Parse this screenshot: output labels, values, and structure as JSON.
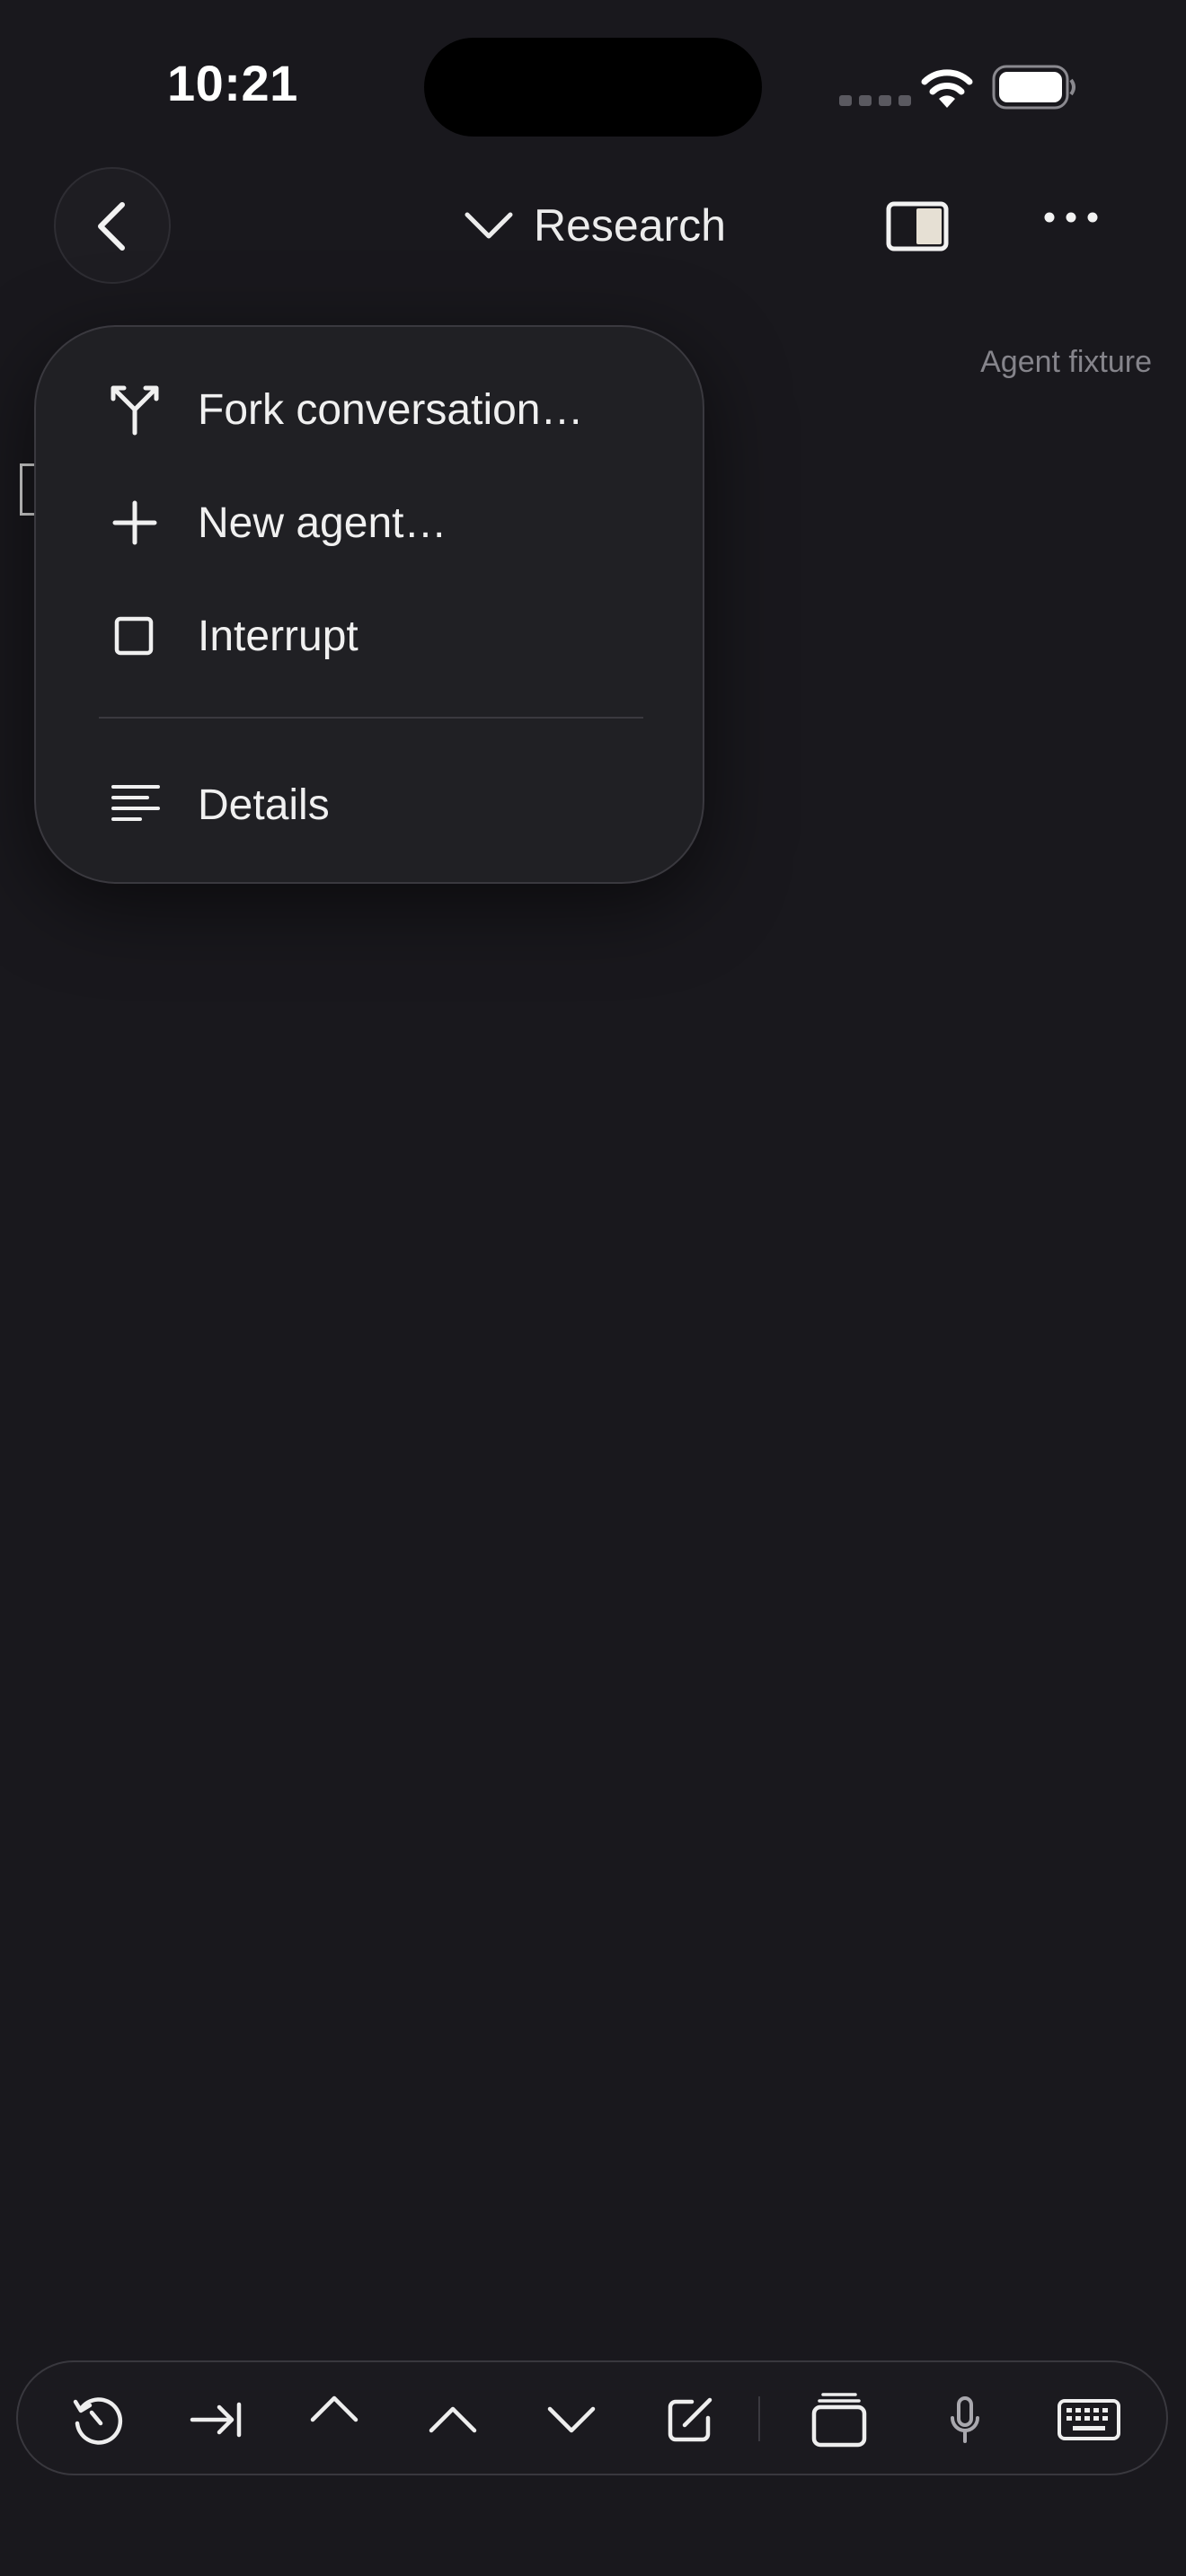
{
  "status_bar": {
    "time": "10:21"
  },
  "nav": {
    "title": "Research",
    "icons": [
      "chevron-left-icon",
      "chevron-down-icon",
      "sidebar-panel-icon",
      "ellipsis-icon"
    ]
  },
  "content": {
    "fixture_label": "Agent fixture"
  },
  "menu": {
    "items": [
      {
        "label": "Fork conversation…",
        "icon": "fork-icon"
      },
      {
        "label": "New agent…",
        "icon": "plus-icon"
      },
      {
        "label": "Interrupt",
        "icon": "stop-square-icon"
      },
      {
        "label": "Details",
        "icon": "text-lines-icon"
      }
    ]
  },
  "toolbar": {
    "icons": [
      "history-icon",
      "tab-arrow-icon",
      "chevron-up-icon",
      "chevron-up-icon",
      "chevron-down-icon",
      "compose-icon",
      "stack-icon",
      "microphone-icon",
      "keyboard-icon"
    ]
  },
  "colors": {
    "background": "#19181d",
    "menu_background": "#202024",
    "text": "#f0f0f0",
    "muted_text": "#85848b"
  }
}
